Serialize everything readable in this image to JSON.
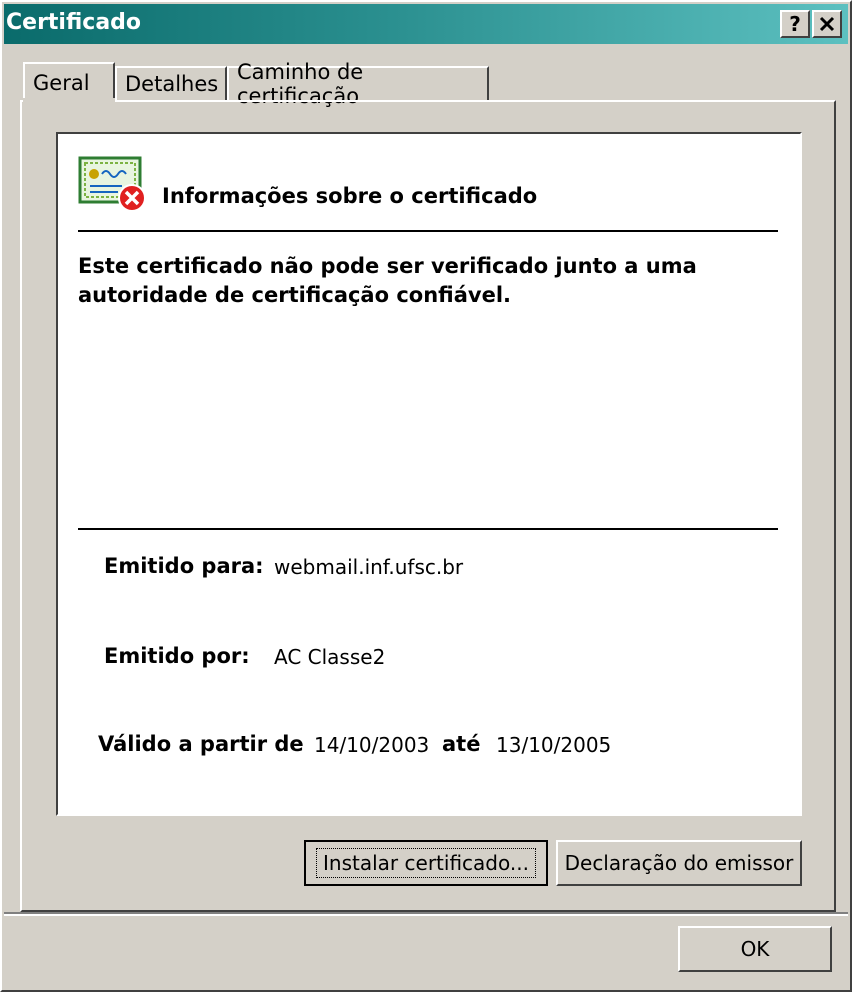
{
  "window": {
    "title": "Certificado",
    "help_button": "?",
    "close_button": "✕"
  },
  "tabs": [
    {
      "label": "Geral",
      "active": true
    },
    {
      "label": "Detalhes",
      "active": false
    },
    {
      "label": "Caminho de certificação",
      "active": false
    }
  ],
  "general": {
    "icon": "certificate-error-icon",
    "heading": "Informações sobre o certificado",
    "message": "Este certificado não pode ser verificado junto a uma autoridade de certificação confiável.",
    "issued_to_label": "Emitido para:",
    "issued_to_value": "webmail.inf.ufsc.br",
    "issued_by_label": "Emitido por:",
    "issued_by_value": "AC Classe2",
    "valid_from_label": "Válido a partir de",
    "valid_from_value": "14/10/2003",
    "valid_to_label": "até",
    "valid_to_value": "13/10/2005"
  },
  "buttons": {
    "install": "Instalar certificado...",
    "issuer_statement": "Declaração do emissor",
    "ok": "OK"
  },
  "colors": {
    "titlebar_start": "#0a6b6b",
    "titlebar_end": "#5cc0c0",
    "face": "#d4d0c8",
    "error_red": "#e02020"
  }
}
